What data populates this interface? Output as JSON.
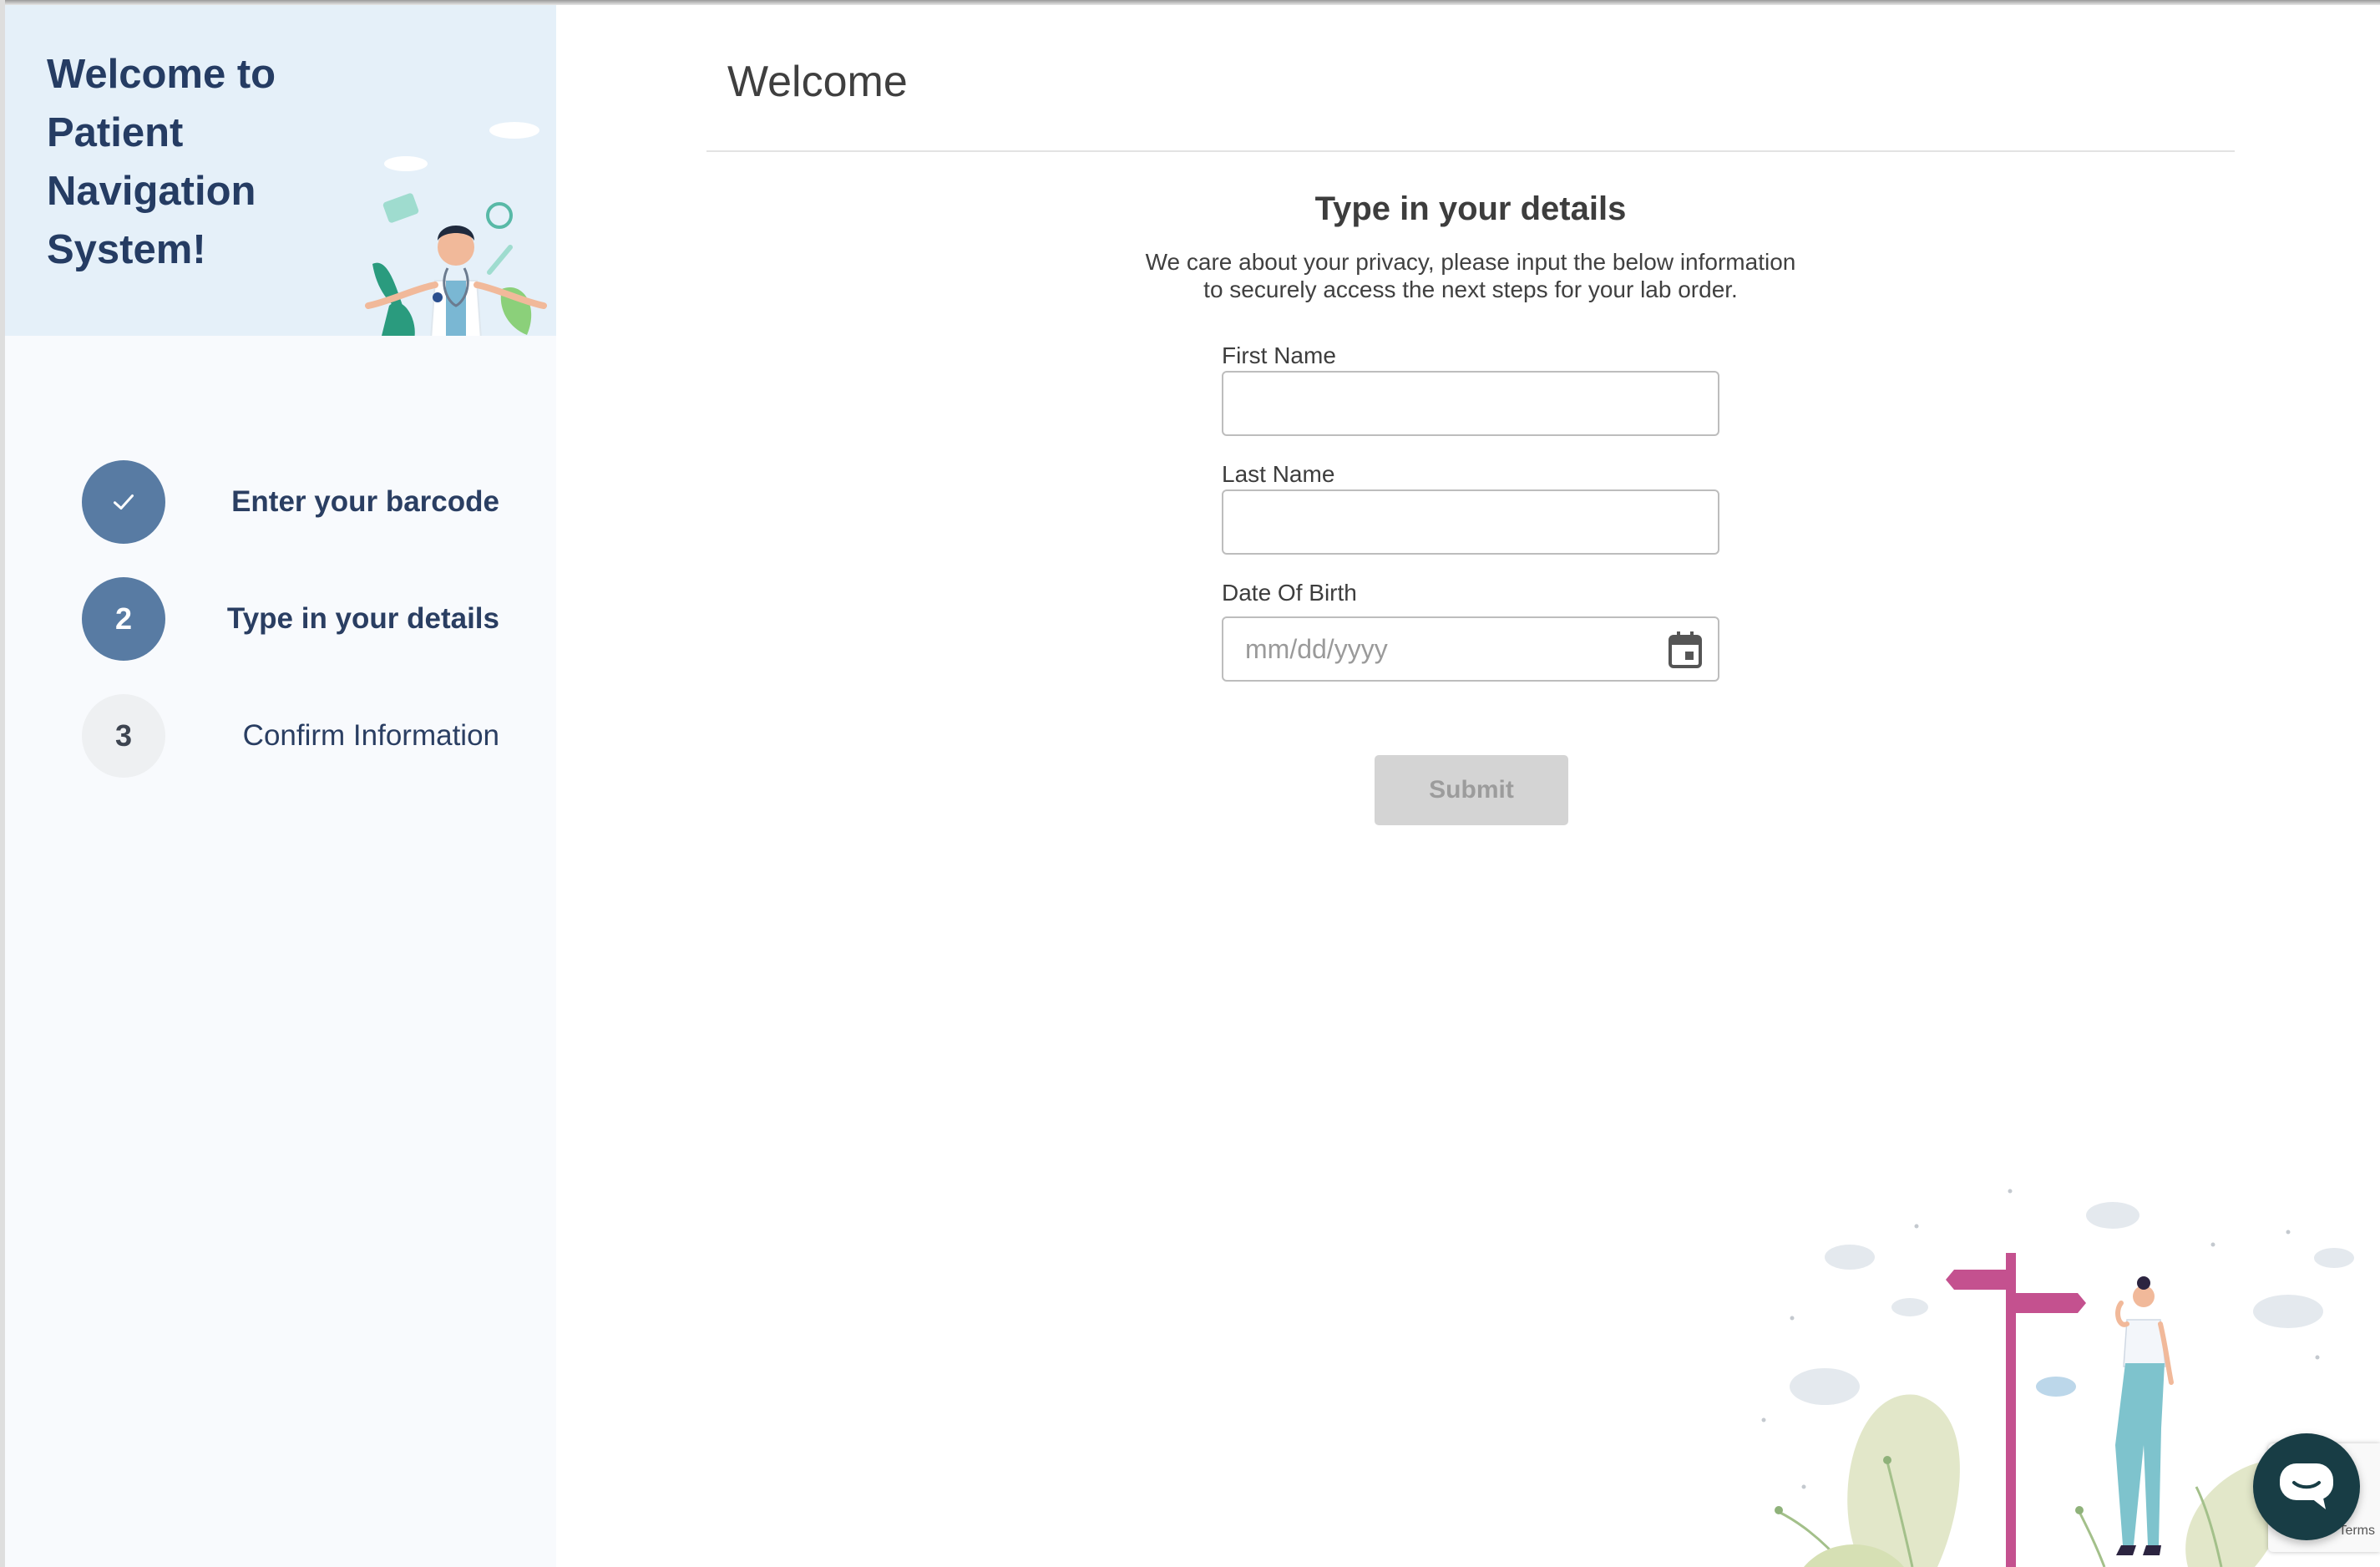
{
  "sidebar": {
    "hero_title": "Welcome to Patient Navigation System!",
    "steps": [
      {
        "number": "",
        "label": "Enter your barcode",
        "state": "completed"
      },
      {
        "number": "2",
        "label": "Type in your details",
        "state": "active"
      },
      {
        "number": "3",
        "label": "Confirm Information",
        "state": "pending"
      }
    ]
  },
  "main": {
    "title": "Welcome",
    "form": {
      "heading": "Type in your details",
      "description_line1": "We care about your privacy, please input the below information",
      "description_line2": "to securely access the next steps for your lab order.",
      "first_name": {
        "label": "First Name",
        "value": ""
      },
      "last_name": {
        "label": "Last Name",
        "value": ""
      },
      "dob": {
        "label": "Date Of Birth",
        "placeholder": "mm/dd/yyyy",
        "value": ""
      },
      "submit_label": "Submit",
      "submit_enabled": false
    }
  },
  "recaptcha": {
    "text": "Terms"
  },
  "colors": {
    "accent": "#587ba3",
    "heading": "#253c63",
    "hero_bg": "#e5f0f9",
    "chat_button": "#183d45"
  },
  "icons": [
    "check-icon",
    "calendar-icon",
    "chat-icon",
    "doctor-illustration",
    "signpost-illustration"
  ]
}
